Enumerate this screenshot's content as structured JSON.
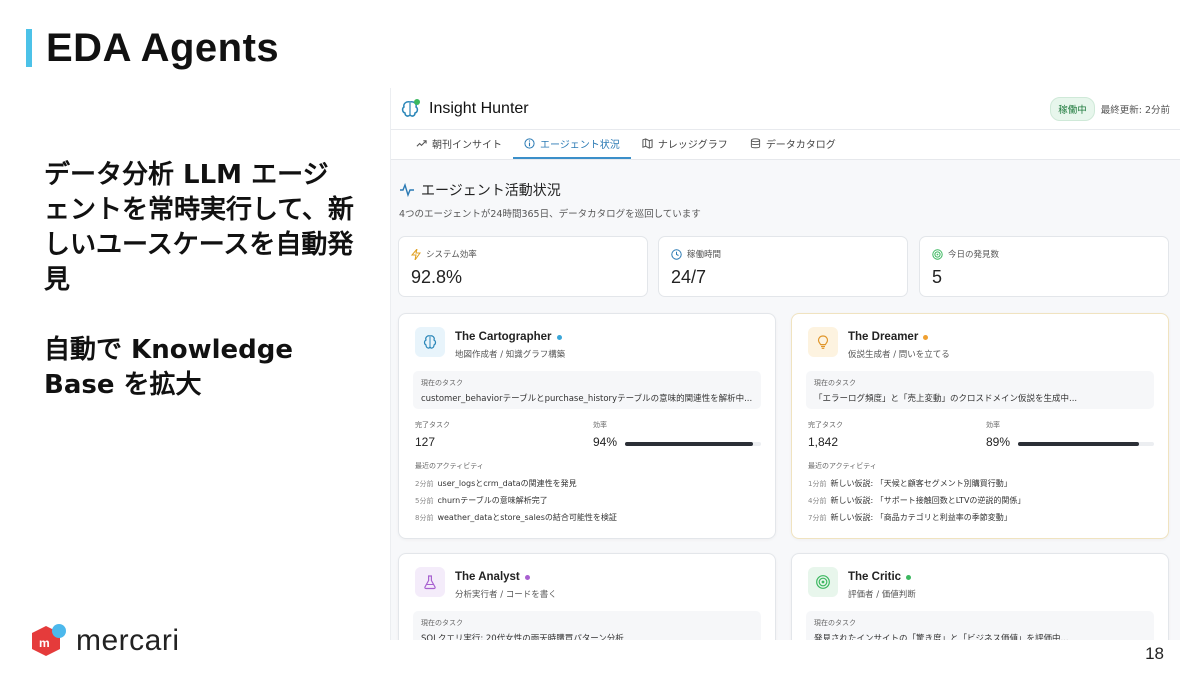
{
  "slide": {
    "title": "EDA Agents",
    "bullet_1": "データ分析 LLM エージェントを常時実行して、新しいユースケースを自動発見",
    "bullet_2": "自動で Knowledge Base を拡大",
    "brand": "mercari",
    "page_number": "18"
  },
  "app": {
    "name": "Insight Hunter",
    "status": "稼働中",
    "last_updated": "最終更新: 2分前",
    "tabs": [
      {
        "label": "朝刊インサイト",
        "icon": "trending-up-icon"
      },
      {
        "label": "エージェント状況",
        "icon": "info-circle-icon",
        "active": true
      },
      {
        "label": "ナレッジグラフ",
        "icon": "map-icon"
      },
      {
        "label": "データカタログ",
        "icon": "database-icon"
      }
    ],
    "section_title": "エージェント活動状況",
    "section_subtitle": "4つのエージェントが24時間365日、データカタログを巡回しています",
    "stats": [
      {
        "label": "システム効率",
        "value": "92.8%",
        "icon": "zap-icon"
      },
      {
        "label": "稼働時間",
        "value": "24/7",
        "icon": "clock-icon"
      },
      {
        "label": "今日の発見数",
        "value": "5",
        "icon": "target-icon"
      }
    ],
    "task_label": "現在のタスク",
    "completed_label": "完了タスク",
    "efficiency_label": "効率",
    "activity_label": "最近のアクティビティ",
    "agents": [
      {
        "name": "The Cartographer",
        "role": "地図作成者 / 知識グラフ構築",
        "status_color": "#3aa6d8",
        "task": "customer_behaviorテーブルとpurchase_historyテーブルの意味的関連性を解析中...",
        "completed": "127",
        "efficiency": "94%",
        "efficiency_value": 94,
        "activities": [
          {
            "ago": "2分前",
            "text": "user_logsとcrm_dataの関連性を発見"
          },
          {
            "ago": "5分前",
            "text": "churnテーブルの意味解析完了"
          },
          {
            "ago": "8分前",
            "text": "weather_dataとstore_salesの結合可能性を検証"
          }
        ]
      },
      {
        "name": "The Dreamer",
        "role": "仮説生成者 / 問いを立てる",
        "status_color": "#f0a030",
        "task": "「エラーログ頻度」と「売上変動」のクロスドメイン仮説を生成中...",
        "completed": "1,842",
        "efficiency": "89%",
        "efficiency_value": 89,
        "activities": [
          {
            "ago": "1分前",
            "text": "新しい仮説: 「天候と顧客セグメント別購買行動」"
          },
          {
            "ago": "4分前",
            "text": "新しい仮説: 「サポート接触回数とLTVの逆説的関係」"
          },
          {
            "ago": "7分前",
            "text": "新しい仮説: 「商品カテゴリと利益率の季節変動」"
          }
        ]
      },
      {
        "name": "The Analyst",
        "role": "分析実行者 / コードを書く",
        "status_color": "#a860d0",
        "task": "SQLクエリ実行: 20代女性の雨天時購買パターン分析"
      },
      {
        "name": "The Critic",
        "role": "評価者 / 価値判断",
        "status_color": "#3cb860",
        "task": "発見されたインサイトの「驚き度」と「ビジネス価値」を評価中..."
      }
    ]
  }
}
